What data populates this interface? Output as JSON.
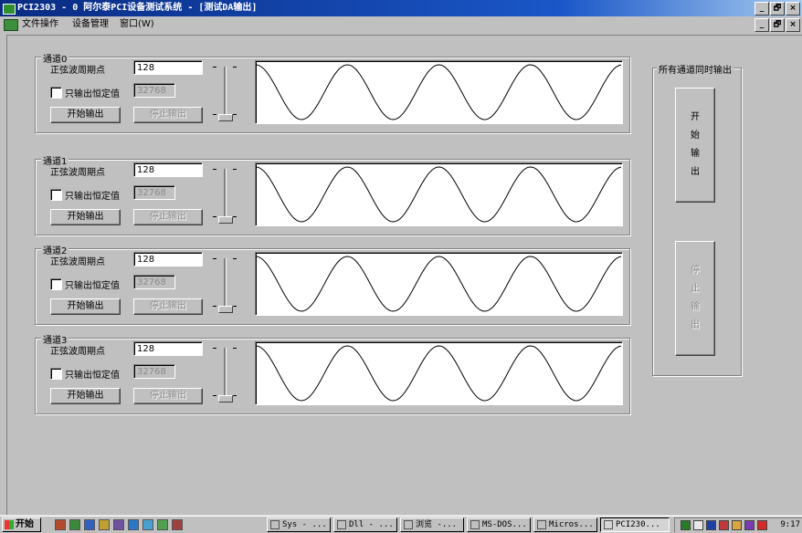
{
  "window": {
    "title": "PCI2303 - 0 阿尔泰PCI设备测试系统 - [测试DA输出]",
    "controls": [
      "_",
      "🗗",
      "×"
    ]
  },
  "menubar": {
    "items": [
      "文件操作",
      "设备管理",
      "窗口(W)"
    ],
    "mdi_controls": [
      "_",
      "🗗",
      "×"
    ]
  },
  "channels": [
    {
      "legend": "通道0",
      "period_label": "正弦波周期点",
      "period_value": "128",
      "const_checkbox_label": "只输出恒定值",
      "const_checked": false,
      "const_value": "32768",
      "start_label": "开始输出",
      "stop_label": "停止输出",
      "slider_position": 1.0
    },
    {
      "legend": "通道1",
      "period_label": "正弦波周期点",
      "period_value": "128",
      "const_checkbox_label": "只输出恒定值",
      "const_checked": false,
      "const_value": "32768",
      "start_label": "开始输出",
      "stop_label": "停止输出",
      "slider_position": 1.0
    },
    {
      "legend": "通道2",
      "period_label": "正弦波周期点",
      "period_value": "128",
      "const_checkbox_label": "只输出恒定值",
      "const_checked": false,
      "const_value": "32768",
      "start_label": "开始输出",
      "stop_label": "停止输出",
      "slider_position": 1.0
    },
    {
      "legend": "通道3",
      "period_label": "正弦波周期点",
      "period_value": "128",
      "const_checkbox_label": "只输出恒定值",
      "const_checked": false,
      "const_value": "32768",
      "start_label": "开始输出",
      "stop_label": "停止输出",
      "slider_position": 1.0
    }
  ],
  "waveform": {
    "cycles": 4,
    "stroke_color": "#000000"
  },
  "all_channels": {
    "legend": "所有通道同时输出",
    "start_chars": [
      "开",
      "始",
      "输",
      "出"
    ],
    "stop_chars": [
      "停",
      "止",
      "输",
      "出"
    ]
  },
  "taskbar": {
    "start_label": "开始",
    "quick_launch_icons": [
      "internet-explorer-icon",
      "folder-icon",
      "search-icon",
      "help-icon",
      "network-icon",
      "ie-icon",
      "window-icon",
      "pen-icon",
      "app-icon"
    ],
    "buttons": [
      {
        "label": "Sys - ...",
        "active": false
      },
      {
        "label": "Dll - ...",
        "active": false
      },
      {
        "label": "浏览 -...",
        "active": false
      },
      {
        "label": "MS-DOS...",
        "active": false
      },
      {
        "label": "Micros...",
        "active": false
      },
      {
        "label": "PCI230...",
        "active": true
      }
    ],
    "clock": "9:17"
  },
  "colors": {
    "title_start": "#0a2b82",
    "title_end": "#a6caf0",
    "face": "#c0c0c0"
  }
}
